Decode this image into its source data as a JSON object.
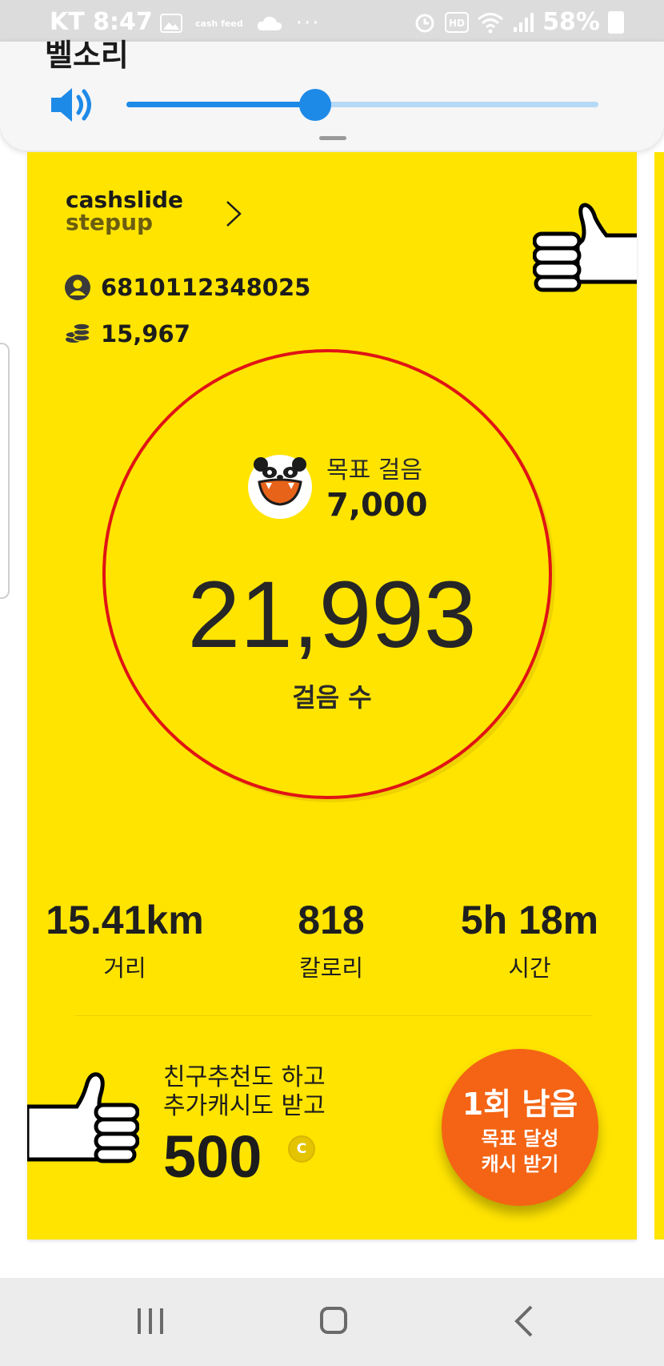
{
  "status_bar": {
    "carrier_time": "KT 8:47",
    "feed_icon_text": "cash feed",
    "more": "···",
    "battery": "58%"
  },
  "volume": {
    "label": "벨소리",
    "level_percent": 40
  },
  "card": {
    "brand_line1": "cashslide",
    "brand_line2": "stepup",
    "user_id": "6810112348025",
    "coins": "15,967",
    "goal_label": "목표 걸음",
    "goal_value": "7,000",
    "steps_value": "21,993",
    "steps_label": "걸음 수",
    "stats": [
      {
        "value": "15.41km",
        "label": "거리"
      },
      {
        "value": "818",
        "label": "칼로리"
      },
      {
        "value": "5h 18m",
        "label": "시간"
      }
    ],
    "promo_line1": "친구추천도 하고",
    "promo_line2": "추가캐시도 받고",
    "promo_amount": "500",
    "coin_symbol": "C",
    "reward_button_title": "1회 남음",
    "reward_button_line1": "목표 달성",
    "reward_button_line2": "캐시 받기"
  },
  "colors": {
    "card_yellow": "#ffe400",
    "ring_red": "#e01414",
    "button_orange": "#f46414",
    "volume_blue": "#1e8ae8"
  },
  "icons": [
    "image-icon",
    "cloud-icon",
    "alarm-icon",
    "hd-icon",
    "wifi-icon",
    "signal-icon",
    "battery-icon",
    "speaker-icon",
    "chevron-right-icon",
    "user-icon",
    "coins-icon",
    "thumbs-up-icon",
    "panda-icon",
    "recent-apps-icon",
    "home-icon",
    "back-icon"
  ]
}
